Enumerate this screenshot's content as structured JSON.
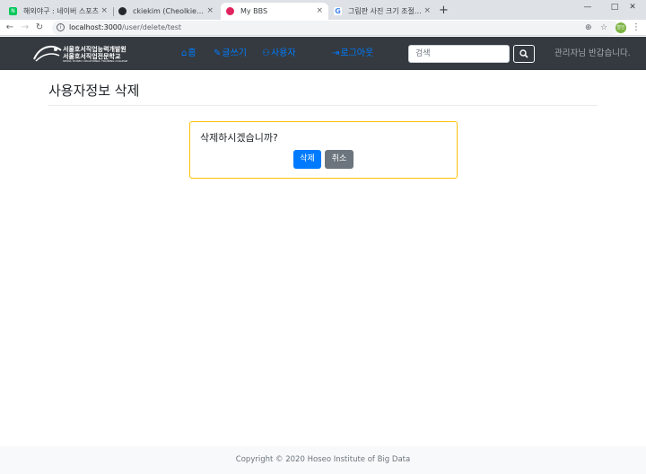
{
  "browser": {
    "tabs": [
      {
        "title": "해외야구 : 네이버 스포츠",
        "favicon_color": "#03c75a",
        "favicon_letter": "N"
      },
      {
        "title": "ckiekim (Cheolkie Kim)",
        "favicon_color": "#24292e",
        "favicon_letter": ""
      },
      {
        "title": "My BBS",
        "favicon_color": "#e0245e",
        "favicon_letter": ""
      },
      {
        "title": "그림판 사진 크기 조절 - Google",
        "favicon_color": "#4285f4",
        "favicon_letter": "G"
      }
    ],
    "close_glyph": "×",
    "new_tab_glyph": "+",
    "url_host": "localhost:3000",
    "url_path": "/user/delete/test",
    "profile_label": "철인",
    "window_controls": {
      "minimize": "—",
      "maximize": "□",
      "close": "✕"
    }
  },
  "navbar": {
    "logo_line1": "서울호서직업능력개발원",
    "logo_line2": "서울호서직업전문학교",
    "logo_line3": "SEOUL HOSEO VOCATIONAL TRAINING COLLEGE",
    "links": {
      "home": "홈",
      "write": "글쓰기",
      "users": "사용자",
      "logout": "로그아웃"
    },
    "search_placeholder": "검색",
    "welcome": "관리자님 반갑습니다."
  },
  "page": {
    "title": "사용자정보 삭제",
    "confirm_question": "삭제하시겠습니까?",
    "delete_label": "삭제",
    "cancel_label": "취소"
  },
  "footer": {
    "copyright": "Copyright © 2020 Hoseo Institute of Big Data"
  },
  "colors": {
    "navbar_bg": "#343a40",
    "link": "#007bff",
    "card_border": "#ffc107",
    "primary": "#007bff",
    "secondary": "#6c757d"
  }
}
